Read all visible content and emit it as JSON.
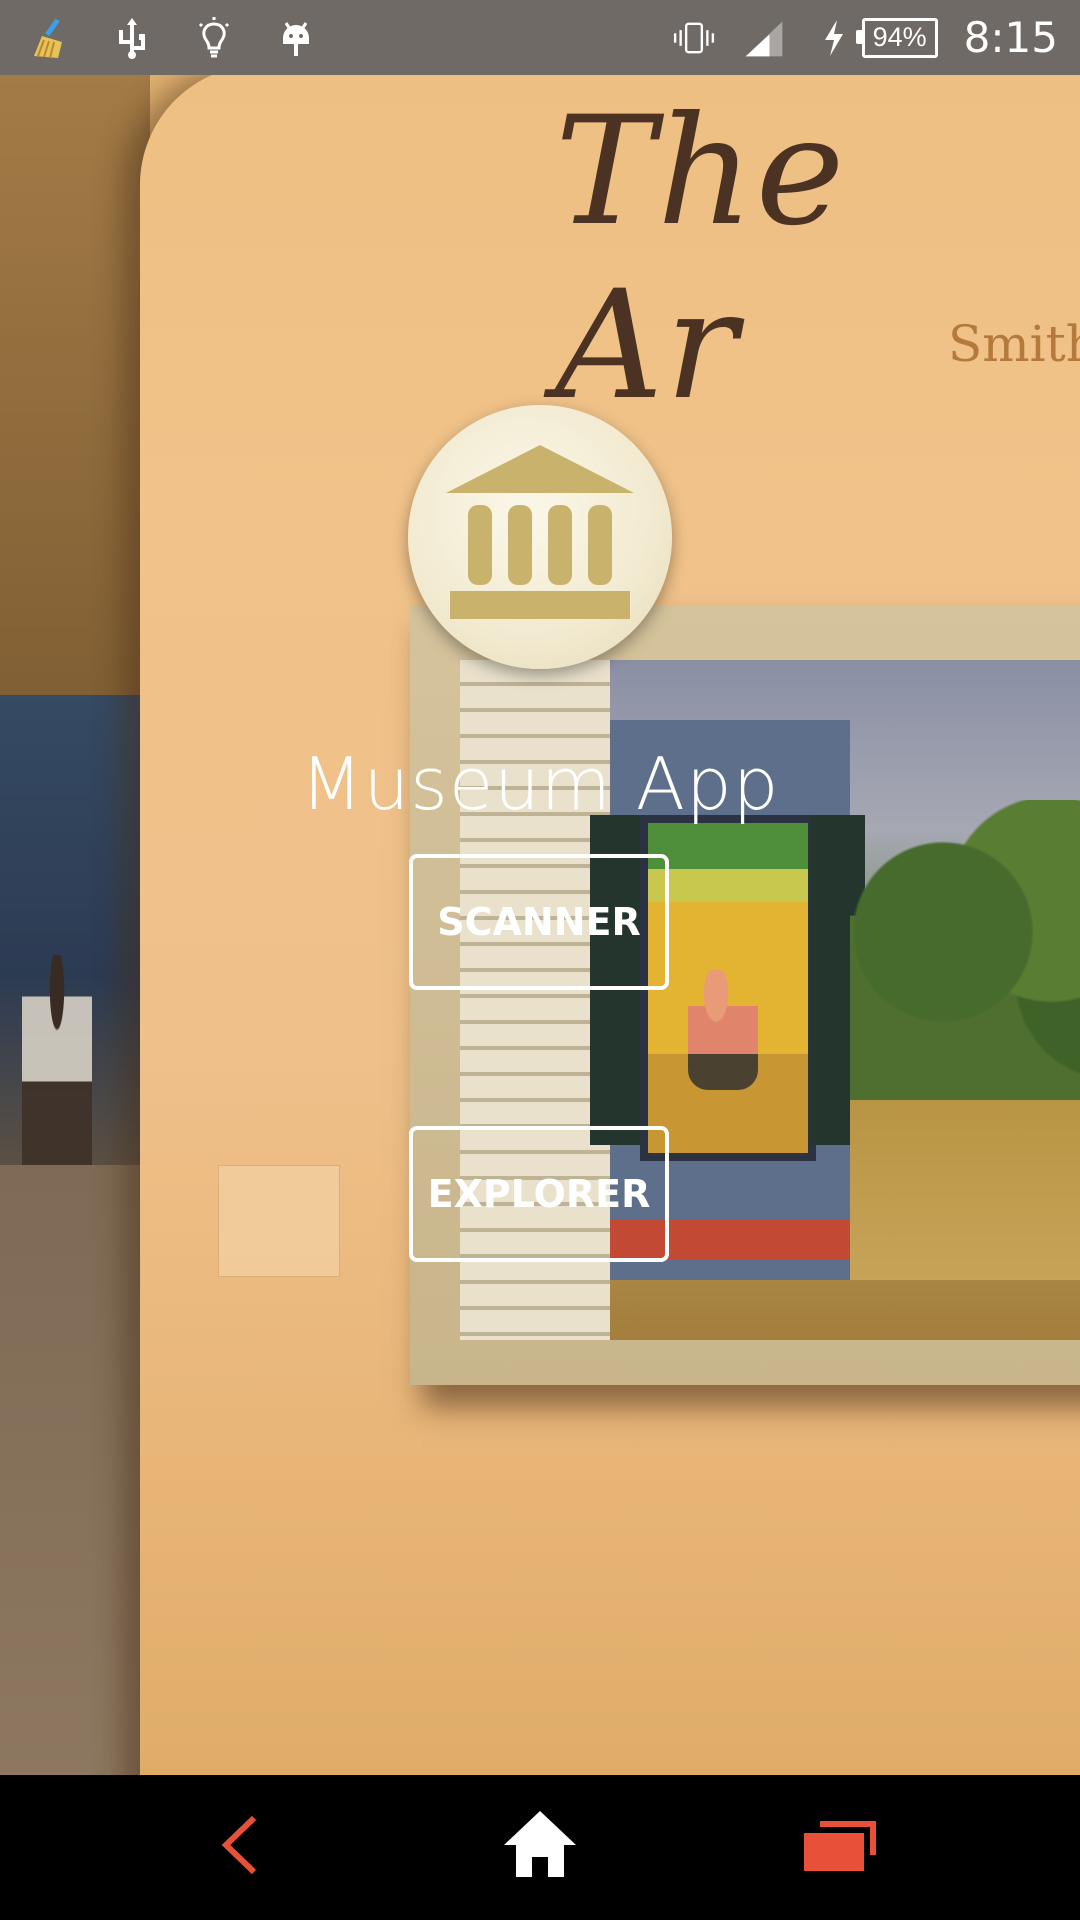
{
  "status_bar": {
    "icons": [
      "broom-icon",
      "usb-icon",
      "lightbulb-icon",
      "android-icon"
    ],
    "battery_percent": "94%",
    "time": "8:15"
  },
  "background_text": {
    "wall_title": "The Ar",
    "wall_subtitle": "Smith"
  },
  "app": {
    "title": "Museum App",
    "logo_icon": "museum-icon",
    "buttons": {
      "scanner": "SCANNER",
      "explorer": "EXPLORER"
    }
  },
  "nav_bar": {
    "back_icon": "back-icon",
    "home_icon": "home-icon",
    "recent_icon": "recent-apps-icon",
    "colors": {
      "back": "#e8503a",
      "home": "#ffffff",
      "recent": "#e8503a"
    }
  },
  "colors": {
    "status_bar_bg": "#6f6a66",
    "logo_gold": "#c9b26b",
    "button_border": "#ffffff"
  }
}
